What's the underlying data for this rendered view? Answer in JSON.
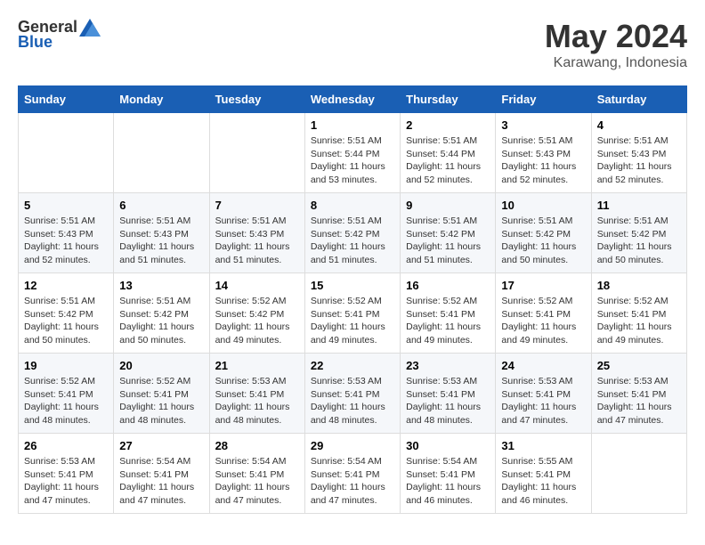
{
  "logo": {
    "general": "General",
    "blue": "Blue"
  },
  "title": "May 2024",
  "subtitle": "Karawang, Indonesia",
  "days_of_week": [
    "Sunday",
    "Monday",
    "Tuesday",
    "Wednesday",
    "Thursday",
    "Friday",
    "Saturday"
  ],
  "weeks": [
    [
      {
        "day": "",
        "info": ""
      },
      {
        "day": "",
        "info": ""
      },
      {
        "day": "",
        "info": ""
      },
      {
        "day": "1",
        "info": "Sunrise: 5:51 AM\nSunset: 5:44 PM\nDaylight: 11 hours\nand 53 minutes."
      },
      {
        "day": "2",
        "info": "Sunrise: 5:51 AM\nSunset: 5:44 PM\nDaylight: 11 hours\nand 52 minutes."
      },
      {
        "day": "3",
        "info": "Sunrise: 5:51 AM\nSunset: 5:43 PM\nDaylight: 11 hours\nand 52 minutes."
      },
      {
        "day": "4",
        "info": "Sunrise: 5:51 AM\nSunset: 5:43 PM\nDaylight: 11 hours\nand 52 minutes."
      }
    ],
    [
      {
        "day": "5",
        "info": "Sunrise: 5:51 AM\nSunset: 5:43 PM\nDaylight: 11 hours\nand 52 minutes."
      },
      {
        "day": "6",
        "info": "Sunrise: 5:51 AM\nSunset: 5:43 PM\nDaylight: 11 hours\nand 51 minutes."
      },
      {
        "day": "7",
        "info": "Sunrise: 5:51 AM\nSunset: 5:43 PM\nDaylight: 11 hours\nand 51 minutes."
      },
      {
        "day": "8",
        "info": "Sunrise: 5:51 AM\nSunset: 5:42 PM\nDaylight: 11 hours\nand 51 minutes."
      },
      {
        "day": "9",
        "info": "Sunrise: 5:51 AM\nSunset: 5:42 PM\nDaylight: 11 hours\nand 51 minutes."
      },
      {
        "day": "10",
        "info": "Sunrise: 5:51 AM\nSunset: 5:42 PM\nDaylight: 11 hours\nand 50 minutes."
      },
      {
        "day": "11",
        "info": "Sunrise: 5:51 AM\nSunset: 5:42 PM\nDaylight: 11 hours\nand 50 minutes."
      }
    ],
    [
      {
        "day": "12",
        "info": "Sunrise: 5:51 AM\nSunset: 5:42 PM\nDaylight: 11 hours\nand 50 minutes."
      },
      {
        "day": "13",
        "info": "Sunrise: 5:51 AM\nSunset: 5:42 PM\nDaylight: 11 hours\nand 50 minutes."
      },
      {
        "day": "14",
        "info": "Sunrise: 5:52 AM\nSunset: 5:42 PM\nDaylight: 11 hours\nand 49 minutes."
      },
      {
        "day": "15",
        "info": "Sunrise: 5:52 AM\nSunset: 5:41 PM\nDaylight: 11 hours\nand 49 minutes."
      },
      {
        "day": "16",
        "info": "Sunrise: 5:52 AM\nSunset: 5:41 PM\nDaylight: 11 hours\nand 49 minutes."
      },
      {
        "day": "17",
        "info": "Sunrise: 5:52 AM\nSunset: 5:41 PM\nDaylight: 11 hours\nand 49 minutes."
      },
      {
        "day": "18",
        "info": "Sunrise: 5:52 AM\nSunset: 5:41 PM\nDaylight: 11 hours\nand 49 minutes."
      }
    ],
    [
      {
        "day": "19",
        "info": "Sunrise: 5:52 AM\nSunset: 5:41 PM\nDaylight: 11 hours\nand 48 minutes."
      },
      {
        "day": "20",
        "info": "Sunrise: 5:52 AM\nSunset: 5:41 PM\nDaylight: 11 hours\nand 48 minutes."
      },
      {
        "day": "21",
        "info": "Sunrise: 5:53 AM\nSunset: 5:41 PM\nDaylight: 11 hours\nand 48 minutes."
      },
      {
        "day": "22",
        "info": "Sunrise: 5:53 AM\nSunset: 5:41 PM\nDaylight: 11 hours\nand 48 minutes."
      },
      {
        "day": "23",
        "info": "Sunrise: 5:53 AM\nSunset: 5:41 PM\nDaylight: 11 hours\nand 48 minutes."
      },
      {
        "day": "24",
        "info": "Sunrise: 5:53 AM\nSunset: 5:41 PM\nDaylight: 11 hours\nand 47 minutes."
      },
      {
        "day": "25",
        "info": "Sunrise: 5:53 AM\nSunset: 5:41 PM\nDaylight: 11 hours\nand 47 minutes."
      }
    ],
    [
      {
        "day": "26",
        "info": "Sunrise: 5:53 AM\nSunset: 5:41 PM\nDaylight: 11 hours\nand 47 minutes."
      },
      {
        "day": "27",
        "info": "Sunrise: 5:54 AM\nSunset: 5:41 PM\nDaylight: 11 hours\nand 47 minutes."
      },
      {
        "day": "28",
        "info": "Sunrise: 5:54 AM\nSunset: 5:41 PM\nDaylight: 11 hours\nand 47 minutes."
      },
      {
        "day": "29",
        "info": "Sunrise: 5:54 AM\nSunset: 5:41 PM\nDaylight: 11 hours\nand 47 minutes."
      },
      {
        "day": "30",
        "info": "Sunrise: 5:54 AM\nSunset: 5:41 PM\nDaylight: 11 hours\nand 46 minutes."
      },
      {
        "day": "31",
        "info": "Sunrise: 5:55 AM\nSunset: 5:41 PM\nDaylight: 11 hours\nand 46 minutes."
      },
      {
        "day": "",
        "info": ""
      }
    ]
  ]
}
